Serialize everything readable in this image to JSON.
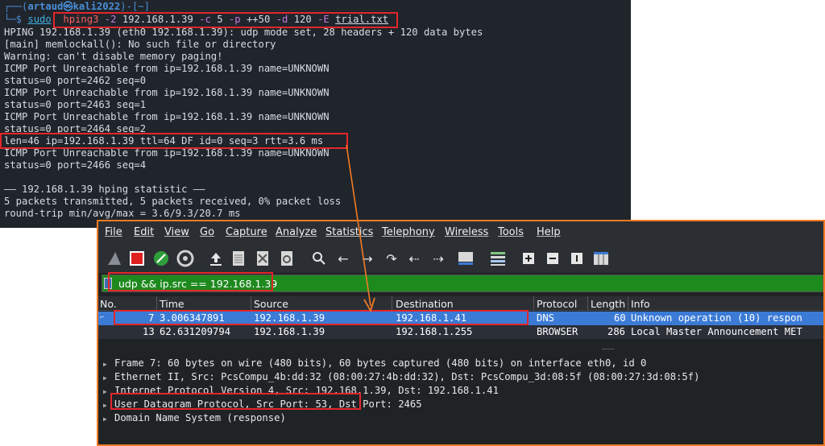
{
  "terminal": {
    "prompt_top_open": "┌──(",
    "prompt_user": "artaud㉿kali2022",
    "prompt_top_close": ")-[~]",
    "prompt_bottom": "└─$",
    "cmd_sudo": "sudo",
    "cmd_main": "hping3",
    "cmd_flag2": "-2",
    "cmd_ip": "192.168.1.39",
    "cmd_flag_c": "-c",
    "cmd_c_val": "5",
    "cmd_flag_p": "-p",
    "cmd_p_val": "++50",
    "cmd_flag_d": "-d",
    "cmd_d_val": "120",
    "cmd_flag_e": "-E",
    "cmd_file": "trial.txt",
    "output": [
      "HPING 192.168.1.39 (eth0 192.168.1.39): udp mode set, 28 headers + 120 data bytes",
      "[main] memlockall(): No such file or directory",
      "Warning: can't disable memory paging!",
      "ICMP Port Unreachable from ip=192.168.1.39 name=UNKNOWN",
      "status=0 port=2462 seq=0",
      "ICMP Port Unreachable from ip=192.168.1.39 name=UNKNOWN",
      "status=0 port=2463 seq=1",
      "ICMP Port Unreachable from ip=192.168.1.39 name=UNKNOWN",
      "status=0 port=2464 seq=2",
      "len=46 ip=192.168.1.39 ttl=64 DF id=0 seq=3 rtt=3.6 ms",
      "ICMP Port Unreachable from ip=192.168.1.39 name=UNKNOWN",
      "status=0 port=2466 seq=4",
      "",
      "—— 192.168.1.39 hping statistic ——",
      "5 packets transmitted, 5 packets received, 0% packet loss",
      "round-trip min/avg/max = 3.6/9.3/20.7 ms"
    ]
  },
  "wireshark": {
    "menu": [
      "File",
      "Edit",
      "View",
      "Go",
      "Capture",
      "Analyze",
      "Statistics",
      "Telephony",
      "Wireless",
      "Tools",
      "Help"
    ],
    "filter": "udp && ip.src == 192.168.1.39",
    "columns": [
      "No.",
      "Time",
      "Source",
      "Destination",
      "Protocol",
      "Length",
      "Info"
    ],
    "packets": [
      {
        "no": "7",
        "time": "3.006347891",
        "source": "192.168.1.39",
        "destination": "192.168.1.41",
        "protocol": "DNS",
        "length": "60",
        "info": "Unknown operation (10) respon"
      },
      {
        "no": "13",
        "time": "62.631209794",
        "source": "192.168.1.39",
        "destination": "192.168.1.255",
        "protocol": "BROWSER",
        "length": "286",
        "info": "Local Master Announcement MET"
      }
    ],
    "details": [
      "Frame 7: 60 bytes on wire (480 bits), 60 bytes captured (480 bits) on interface eth0, id 0",
      "Ethernet II, Src: PcsCompu_4b:dd:32 (08:00:27:4b:dd:32), Dst: PcsCompu_3d:08:5f (08:00:27:3d:08:5f)",
      "Internet Protocol Version 4, Src: 192.168.1.39, Dst: 192.168.1.41",
      "User Datagram Protocol, Src Port: 53, Dst Port: 2465",
      "Domain Name System (response)"
    ],
    "toolbar_icons": [
      "shark-fin-start-icon",
      "stop-icon",
      "restart-icon",
      "options-gear-icon",
      "open-upload-icon",
      "file-icon",
      "close-file-icon",
      "reload-icon",
      "search-icon",
      "back-arrow-icon",
      "forward-arrow-icon",
      "go-to-packet-icon",
      "first-packet-icon",
      "last-packet-icon",
      "autoscroll-icon",
      "colorize-icon",
      "zoom-in-icon",
      "zoom-out-icon",
      "normal-size-icon",
      "resize-columns-icon"
    ]
  },
  "colors": {
    "annotation_red": "#e3262b",
    "annotation_orange": "#f27a24",
    "selected_row": "#3b7bd6",
    "filter_green": "#1e8a1e"
  }
}
